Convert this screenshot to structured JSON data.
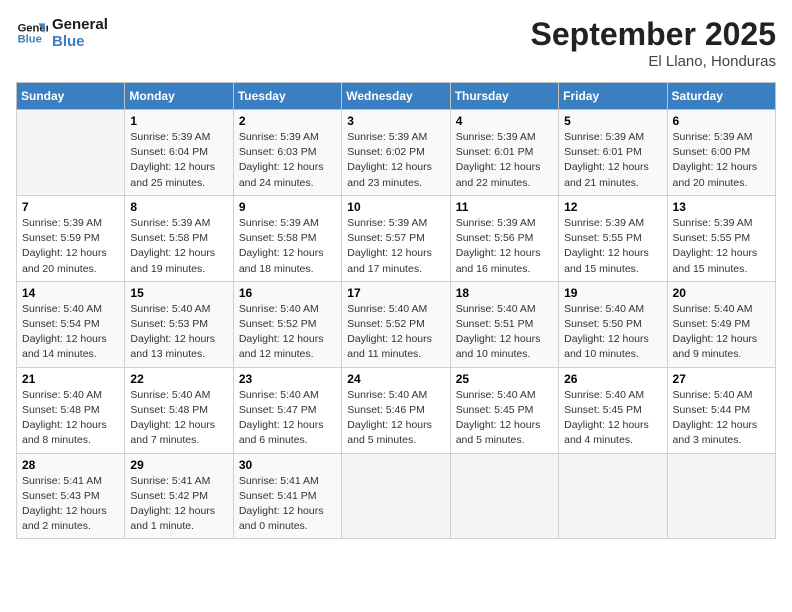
{
  "logo": {
    "line1": "General",
    "line2": "Blue"
  },
  "title": "September 2025",
  "subtitle": "El Llano, Honduras",
  "days_of_week": [
    "Sunday",
    "Monday",
    "Tuesday",
    "Wednesday",
    "Thursday",
    "Friday",
    "Saturday"
  ],
  "weeks": [
    [
      {
        "day": "",
        "info": ""
      },
      {
        "day": "1",
        "info": "Sunrise: 5:39 AM\nSunset: 6:04 PM\nDaylight: 12 hours\nand 25 minutes."
      },
      {
        "day": "2",
        "info": "Sunrise: 5:39 AM\nSunset: 6:03 PM\nDaylight: 12 hours\nand 24 minutes."
      },
      {
        "day": "3",
        "info": "Sunrise: 5:39 AM\nSunset: 6:02 PM\nDaylight: 12 hours\nand 23 minutes."
      },
      {
        "day": "4",
        "info": "Sunrise: 5:39 AM\nSunset: 6:01 PM\nDaylight: 12 hours\nand 22 minutes."
      },
      {
        "day": "5",
        "info": "Sunrise: 5:39 AM\nSunset: 6:01 PM\nDaylight: 12 hours\nand 21 minutes."
      },
      {
        "day": "6",
        "info": "Sunrise: 5:39 AM\nSunset: 6:00 PM\nDaylight: 12 hours\nand 20 minutes."
      }
    ],
    [
      {
        "day": "7",
        "info": "Sunrise: 5:39 AM\nSunset: 5:59 PM\nDaylight: 12 hours\nand 20 minutes."
      },
      {
        "day": "8",
        "info": "Sunrise: 5:39 AM\nSunset: 5:58 PM\nDaylight: 12 hours\nand 19 minutes."
      },
      {
        "day": "9",
        "info": "Sunrise: 5:39 AM\nSunset: 5:58 PM\nDaylight: 12 hours\nand 18 minutes."
      },
      {
        "day": "10",
        "info": "Sunrise: 5:39 AM\nSunset: 5:57 PM\nDaylight: 12 hours\nand 17 minutes."
      },
      {
        "day": "11",
        "info": "Sunrise: 5:39 AM\nSunset: 5:56 PM\nDaylight: 12 hours\nand 16 minutes."
      },
      {
        "day": "12",
        "info": "Sunrise: 5:39 AM\nSunset: 5:55 PM\nDaylight: 12 hours\nand 15 minutes."
      },
      {
        "day": "13",
        "info": "Sunrise: 5:39 AM\nSunset: 5:55 PM\nDaylight: 12 hours\nand 15 minutes."
      }
    ],
    [
      {
        "day": "14",
        "info": "Sunrise: 5:40 AM\nSunset: 5:54 PM\nDaylight: 12 hours\nand 14 minutes."
      },
      {
        "day": "15",
        "info": "Sunrise: 5:40 AM\nSunset: 5:53 PM\nDaylight: 12 hours\nand 13 minutes."
      },
      {
        "day": "16",
        "info": "Sunrise: 5:40 AM\nSunset: 5:52 PM\nDaylight: 12 hours\nand 12 minutes."
      },
      {
        "day": "17",
        "info": "Sunrise: 5:40 AM\nSunset: 5:52 PM\nDaylight: 12 hours\nand 11 minutes."
      },
      {
        "day": "18",
        "info": "Sunrise: 5:40 AM\nSunset: 5:51 PM\nDaylight: 12 hours\nand 10 minutes."
      },
      {
        "day": "19",
        "info": "Sunrise: 5:40 AM\nSunset: 5:50 PM\nDaylight: 12 hours\nand 10 minutes."
      },
      {
        "day": "20",
        "info": "Sunrise: 5:40 AM\nSunset: 5:49 PM\nDaylight: 12 hours\nand 9 minutes."
      }
    ],
    [
      {
        "day": "21",
        "info": "Sunrise: 5:40 AM\nSunset: 5:48 PM\nDaylight: 12 hours\nand 8 minutes."
      },
      {
        "day": "22",
        "info": "Sunrise: 5:40 AM\nSunset: 5:48 PM\nDaylight: 12 hours\nand 7 minutes."
      },
      {
        "day": "23",
        "info": "Sunrise: 5:40 AM\nSunset: 5:47 PM\nDaylight: 12 hours\nand 6 minutes."
      },
      {
        "day": "24",
        "info": "Sunrise: 5:40 AM\nSunset: 5:46 PM\nDaylight: 12 hours\nand 5 minutes."
      },
      {
        "day": "25",
        "info": "Sunrise: 5:40 AM\nSunset: 5:45 PM\nDaylight: 12 hours\nand 5 minutes."
      },
      {
        "day": "26",
        "info": "Sunrise: 5:40 AM\nSunset: 5:45 PM\nDaylight: 12 hours\nand 4 minutes."
      },
      {
        "day": "27",
        "info": "Sunrise: 5:40 AM\nSunset: 5:44 PM\nDaylight: 12 hours\nand 3 minutes."
      }
    ],
    [
      {
        "day": "28",
        "info": "Sunrise: 5:41 AM\nSunset: 5:43 PM\nDaylight: 12 hours\nand 2 minutes."
      },
      {
        "day": "29",
        "info": "Sunrise: 5:41 AM\nSunset: 5:42 PM\nDaylight: 12 hours\nand 1 minute."
      },
      {
        "day": "30",
        "info": "Sunrise: 5:41 AM\nSunset: 5:41 PM\nDaylight: 12 hours\nand 0 minutes."
      },
      {
        "day": "",
        "info": ""
      },
      {
        "day": "",
        "info": ""
      },
      {
        "day": "",
        "info": ""
      },
      {
        "day": "",
        "info": ""
      }
    ]
  ]
}
